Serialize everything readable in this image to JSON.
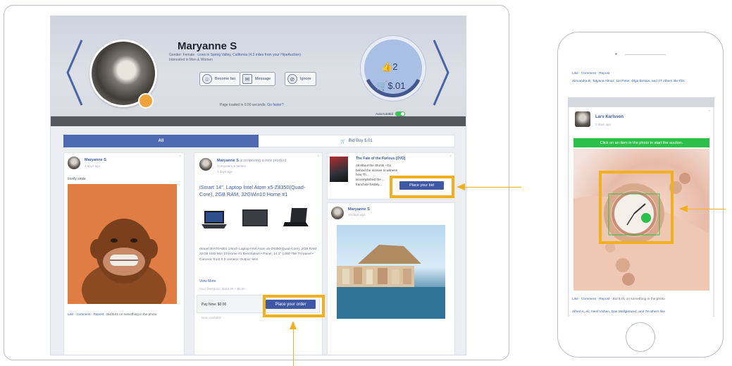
{
  "profile": {
    "name": "Maryanne S",
    "gender_line": "Gender: Female",
    "location_line": "Lives in Spring Valley, California (4.2 miles from your HipeAuction)",
    "interest_line": "Interested in Men & Women",
    "buttons": [
      {
        "label": "Become fan",
        "icon": "fan-icon"
      },
      {
        "label": "Message",
        "icon": "message-icon"
      },
      {
        "label": "Ignore",
        "icon": "ignore-icon"
      }
    ],
    "loaded_text": "Page loaded in 0.00 seconds.",
    "loaded_link": "Go faster?",
    "likes": "2",
    "price": "$.01",
    "auto_label": "AutoAutoBid"
  },
  "tabs": {
    "all": "All",
    "bid_buy": "Bid Buy $.01"
  },
  "posts": {
    "left": {
      "author": "Maryanne S",
      "time": "4 days ago",
      "text": "lovely smile",
      "footer_links": "Like · Comment · Repost",
      "footer_rest": "· Bid $.01 on something in the photo"
    },
    "middle": {
      "author": "Maryanne S",
      "action": "is proposing a new product",
      "category": "Computers & tablets",
      "time": "1 days ago",
      "title": "iSmart 14\", Laptop Intel Atom x5-Z8350(Quad-Core), 2GB RAM, 32GWin10 Home #1",
      "description": "iSmart BIAT0A001 14inch Laptop Intel Atom x5-Z8350(Quad-Core), 2GB RAM, 32GB SSD Win 10 Home #1 Description • Panel: 14.1\" 1366*768 TN panel • Camera: front 0.3 camera; Output: Mini",
      "view_more": "View More",
      "final_price": "Your final price: $442.00 + $0.00",
      "pay_now": "Pay Now: $0.00",
      "order_button": "Place your order",
      "stock_note": "Now available"
    },
    "right_top": {
      "title": "The Fate of the Furious (DVD)",
      "text_1": "All About the Stunts - Go behind the scenes to witness how Th...",
      "text_2": "accomplished the ...",
      "text_3": "franchise history...",
      "bid_button": "Place your bid"
    },
    "right_bottom": {
      "author": "Maryanne S",
      "time": "10 days ago"
    }
  },
  "phone": {
    "top_links": "Like · Comment · Repost",
    "top_likes": "Alexandra B, Tatyana Almaz, Lin Peter, Olga Belova, and 27 others like this.",
    "author": "Lars Karlsson",
    "time": "3 days ago",
    "banner": "Click on an item in the photo to start the auction.",
    "bottom_links": "Like · Comment · Repost",
    "bottom_rest": "· Bid $.01 on something in the photo",
    "bottom_likes": "Alfred A, Ali, Neel Vishen, Das Wellglenced, and 78 others like"
  },
  "colors": {
    "accent": "#f2b01e",
    "brand": "#3e58a5",
    "green": "#2cbf4a"
  }
}
